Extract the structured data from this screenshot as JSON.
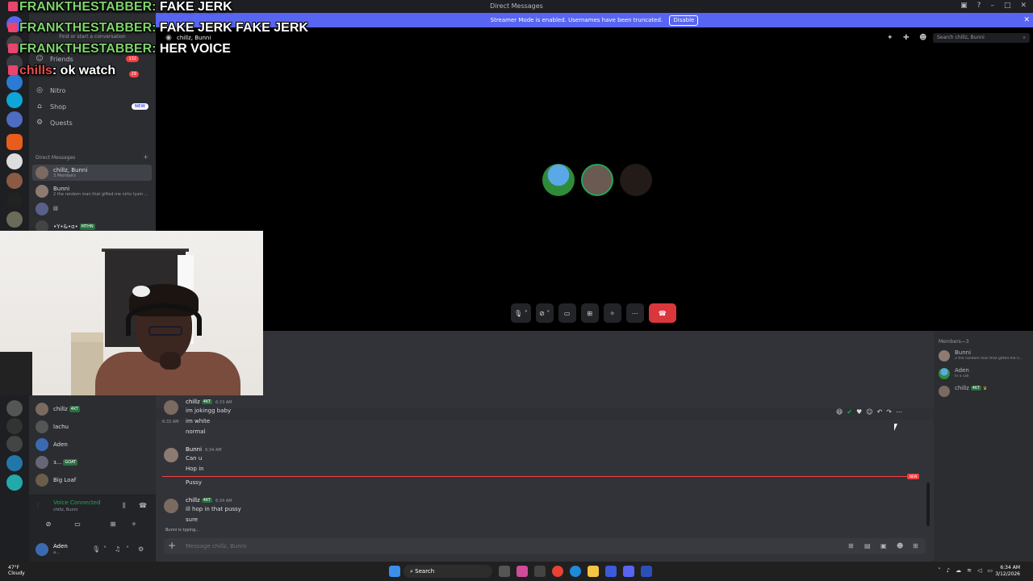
{
  "titlebar": {
    "title": "Direct Messages",
    "min": "–",
    "max": "□",
    "close": "✕"
  },
  "banner": {
    "text": "Streamer Mode is enabled. Usernames have been truncated.",
    "button": "Disable"
  },
  "sidebar": {
    "search_placeholder": "Find or start a conversation",
    "nav": [
      {
        "label": "Friends",
        "icon": "friends-icon",
        "count": "132"
      },
      {
        "label": "",
        "icon": "",
        "count": "29"
      },
      {
        "label": "Nitro",
        "icon": "nitro-icon"
      },
      {
        "label": "Shop",
        "icon": "shop-icon",
        "badge": "NEW"
      },
      {
        "label": "Quests",
        "icon": "quests-icon"
      }
    ],
    "dm_header": "Direct Messages",
    "dms": [
      {
        "name": "chillz, Bunni",
        "sub": "3 Members"
      },
      {
        "name": "Bunni",
        "sub": "2 the random man that gifted me nirto tysm ..."
      },
      {
        "name": "lll",
        "sub": ""
      },
      {
        "name": "•Y•&•ɑ•",
        "tag": "MTHN"
      }
    ],
    "dms_lower": [
      {
        "name": "chillz",
        "tag": "4KT"
      },
      {
        "name": "lachu"
      },
      {
        "name": "Aden"
      },
      {
        "name": "ɜ...",
        "tag": "GOAT"
      },
      {
        "name": "Big Loaf"
      }
    ],
    "voice": {
      "title": "Voice Connected",
      "sub": "chillz, Bunni"
    },
    "user": {
      "name": "Aden",
      "status": "a..."
    }
  },
  "header": {
    "name": "chillz, Bunni",
    "search_placeholder": "Search chillz, Bunni"
  },
  "stream_chat": [
    {
      "user": "FRANKTHESTABBER:",
      "text": "FAKE JERK"
    },
    {
      "user": "FRANKTHESTABBER:",
      "text": "FAKE JERK FAKE JERK"
    },
    {
      "user": "FRANKTHESTABBER:",
      "text": "HER VOICE"
    },
    {
      "user": "chills",
      "text": ": ok watch"
    }
  ],
  "messages": [
    {
      "author": "chillz",
      "tag": "4KT",
      "time": "6:33 AM",
      "lines": [
        "im jokingg baby",
        "im white",
        "normal"
      ],
      "side_time": "6:33 AM"
    },
    {
      "author": "Bunni",
      "time": "6:34 AM",
      "lines": [
        "Can u",
        "Hop in",
        "Pussy"
      ]
    },
    {
      "author": "chillz",
      "tag": "4KT",
      "time": "6:34 AM",
      "lines": [
        "ill hop in that pussy",
        "sure"
      ]
    }
  ],
  "new_label": "NEW",
  "typing": "Bunni is typing...",
  "composer_placeholder": "Message chillz, Bunni",
  "members": {
    "header": "Members—3",
    "list": [
      {
        "name": "Bunni",
        "sub": "2 the random man that gifted me n..."
      },
      {
        "name": "Aden",
        "sub": "In a call"
      },
      {
        "name": "chillz",
        "tag": "4KT"
      }
    ]
  },
  "taskbar": {
    "temp": "47°F",
    "weather": "Cloudy",
    "search": "Search",
    "time": "6:34 AM",
    "date": "3/12/2026"
  },
  "colors": {
    "blurple": "#5865f2",
    "green": "#23a55a",
    "red": "#da373c"
  }
}
